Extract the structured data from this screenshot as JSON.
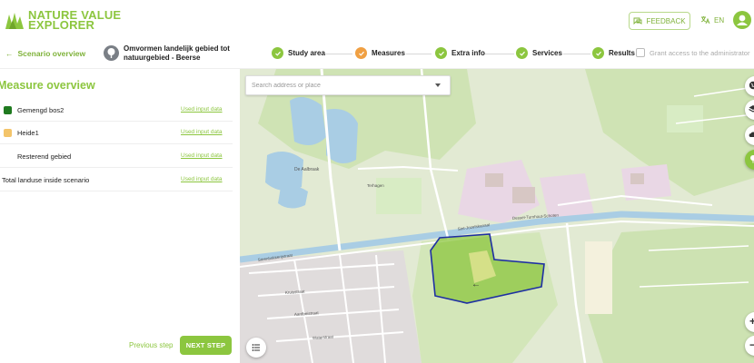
{
  "app": {
    "logo_line1": "NATURE VALUE",
    "logo_line2": "EXPLORER",
    "feedback_label": "FEEDBACK",
    "language": "EN"
  },
  "stepbar": {
    "back_label": "Scenario overview",
    "scenario_title": "Omvormen landelijk gebied tot natuurgebied - Beerse",
    "steps": [
      {
        "label": "Study area",
        "state": "done"
      },
      {
        "label": "Measures",
        "state": "active"
      },
      {
        "label": "Extra info",
        "state": "done"
      },
      {
        "label": "Services",
        "state": "done"
      },
      {
        "label": "Results",
        "state": "done"
      }
    ],
    "grant_label": "Grant access to the administrator"
  },
  "panel": {
    "title": "Measure overview",
    "rows": [
      {
        "label": "Gemengd bos2",
        "link": "Used input data",
        "color": "#1f7a1f"
      },
      {
        "label": "Heide1",
        "link": "Used input data",
        "color": "#f3c46a"
      },
      {
        "label": "Resterend gebied",
        "link": "Used input data",
        "color": ""
      },
      {
        "label": "Total landuse inside scenario",
        "link": "Used input data",
        "color": ""
      }
    ],
    "prev_label": "Previous step",
    "next_label": "NEXT STEP"
  },
  "map": {
    "search_placeholder": "Search address or place",
    "street_labels": {
      "canal": "Sint-Jozefskanaal",
      "canal_b": "Dessel-Turnhout-Schoten",
      "street_1": "Steenbakkerijstraat",
      "street_2": "Kruisstraat",
      "street_3": "Aardbeistraat",
      "street_4": "Waterstraat",
      "area_1": "De Aalbraak",
      "area_2": "Terhagen"
    },
    "colors": {
      "accent": "#8cc63f",
      "polygon_stroke": "#1e2fa3",
      "forest_fill": "#8cc63f",
      "heath_fill": "#d8e08a"
    },
    "zoom_in": "+",
    "zoom_out": "−"
  }
}
